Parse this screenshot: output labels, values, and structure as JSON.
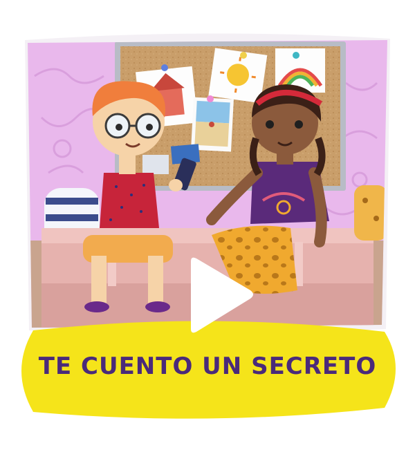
{
  "video": {
    "title": "TE CUENTO UN SECRETO",
    "play_icon": "play-icon"
  },
  "colors": {
    "wall": "#e9b8ec",
    "pill": "#f5e41a",
    "title_text": "#4a2a7a",
    "corkboard": "#c79a64",
    "bench": "#e8b7b4"
  }
}
